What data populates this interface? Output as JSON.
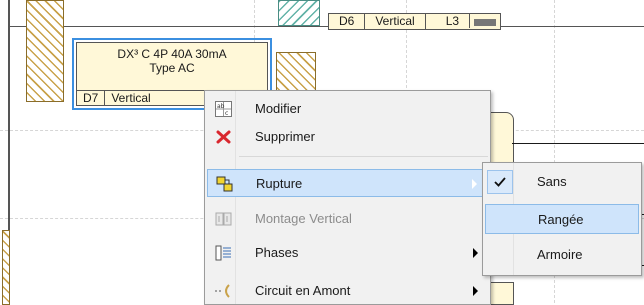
{
  "schematic": {
    "top_module_cells": [
      "D6",
      "Vertical",
      "L3"
    ],
    "selected_module": {
      "title_line1": "DX³ C 4P 40A 30mA",
      "title_line2": "Type AC",
      "cells": [
        "D7",
        "Vertical"
      ]
    }
  },
  "context_menu": {
    "items": [
      {
        "label": "Modifier",
        "icon": "edit-properties-icon",
        "state": "normal",
        "has_submenu": false
      },
      {
        "label": "Supprimer",
        "icon": "delete-x-icon",
        "state": "normal",
        "has_submenu": false
      },
      {
        "label": "Rupture",
        "icon": "break-icon",
        "state": "hover",
        "has_submenu": true
      },
      {
        "label": "Montage Vertical",
        "icon": "vertical-mount-icon",
        "state": "disabled",
        "has_submenu": false
      },
      {
        "label": "Phases",
        "icon": "phases-icon",
        "state": "normal",
        "has_submenu": true
      },
      {
        "label": "Circuit en Amont",
        "icon": "upstream-circuit-icon",
        "state": "normal",
        "has_submenu": true
      }
    ]
  },
  "submenu": {
    "items": [
      {
        "label": "Sans",
        "checked": true
      },
      {
        "label": "Rangée",
        "checked": false,
        "hover": true
      },
      {
        "label": "Armoire",
        "checked": false
      }
    ]
  },
  "colors": {
    "selection_outline": "#3b8fe0",
    "menu_hover": "#cfe4fb",
    "delete_red": "#d9272e",
    "module_fill": "#fff8d8"
  }
}
